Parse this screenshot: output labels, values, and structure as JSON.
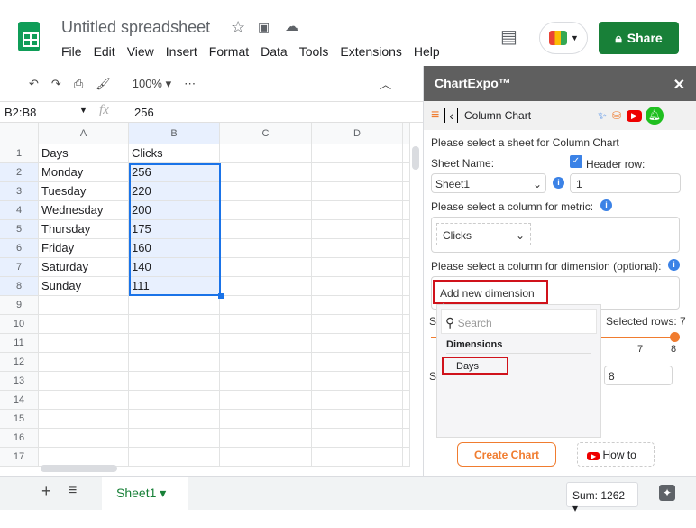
{
  "app": {
    "title": "Untitled spreadsheet",
    "menu": [
      "File",
      "Edit",
      "View",
      "Insert",
      "Format",
      "Data",
      "Tools",
      "Extensions",
      "Help"
    ],
    "share_label": "Share"
  },
  "toolbar": {
    "zoom": "100%"
  },
  "formula": {
    "range": "B2:B8",
    "fx": "fx",
    "value": "256"
  },
  "grid": {
    "columns": [
      "A",
      "B",
      "C",
      "D"
    ],
    "rows": [
      [
        "Days",
        "Clicks"
      ],
      [
        "Monday",
        "256"
      ],
      [
        "Tuesday",
        "220"
      ],
      [
        "Wednesday",
        "200"
      ],
      [
        "Thursday",
        "175"
      ],
      [
        "Friday",
        "160"
      ],
      [
        "Saturday",
        "140"
      ],
      [
        "Sunday",
        "111"
      ],
      [
        "",
        ""
      ],
      [
        "",
        ""
      ],
      [
        "",
        ""
      ],
      [
        "",
        ""
      ],
      [
        "",
        ""
      ],
      [
        "",
        ""
      ],
      [
        "",
        ""
      ],
      [
        "",
        ""
      ],
      [
        "",
        ""
      ]
    ],
    "row_numbers": [
      "1",
      "2",
      "3",
      "4",
      "5",
      "6",
      "7",
      "8",
      "9",
      "10",
      "11",
      "12",
      "13",
      "14",
      "15",
      "16",
      "17"
    ]
  },
  "bottom": {
    "sheet_tab": "Sheet1",
    "sum": "Sum: 1262"
  },
  "sidebar": {
    "title": "ChartExpo™",
    "chart_name": "Column Chart",
    "sheet_prompt": "Please select a sheet for Column Chart",
    "sheet_name_label": "Sheet Name:",
    "sheet_value": "Sheet1",
    "header_row_label": "Header row:",
    "header_row_checked": true,
    "header_row_value": "1",
    "metric_prompt": "Please select a column for metric:",
    "metric_value": "Clicks",
    "dimension_prompt": "Please select a column for dimension (optional):",
    "add_dimension": "Add new dimension",
    "search_placeholder": "Search",
    "dropdown_heading": "Dimensions",
    "dropdown_items": [
      "Days"
    ],
    "selected_rows": "Selected rows: 7",
    "slider_ticks": [
      "7",
      "8"
    ],
    "row_end_value": "8",
    "hidden_label_1": "S",
    "hidden_label_2": "S",
    "create_chart": "Create Chart",
    "how_to": "How to",
    "accent": "#f07c2f"
  }
}
